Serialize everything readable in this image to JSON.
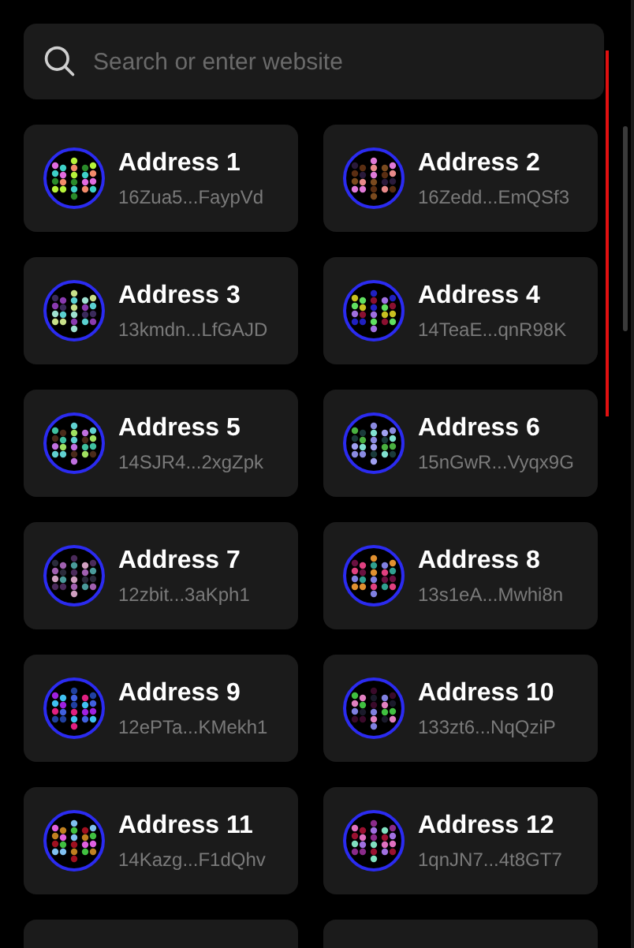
{
  "search": {
    "placeholder": "Search or enter website"
  },
  "addresses": [
    {
      "name": "Address 1",
      "address": "16Zua5...FaypVd"
    },
    {
      "name": "Address 2",
      "address": "16Zedd...EmQSf3"
    },
    {
      "name": "Address 3",
      "address": "13kmdn...LfGAJD"
    },
    {
      "name": "Address 4",
      "address": "14TeaE...qnR98K"
    },
    {
      "name": "Address 5",
      "address": "14SJR4...2xgZpk"
    },
    {
      "name": "Address 6",
      "address": "15nGwR...Vyqx9G"
    },
    {
      "name": "Address 7",
      "address": "12zbit...3aKph1"
    },
    {
      "name": "Address 8",
      "address": "13s1eA...Mwhi8n"
    },
    {
      "name": "Address 9",
      "address": "12ePTa...KMekh1"
    },
    {
      "name": "Address 10",
      "address": "133zt6...NqQziP"
    },
    {
      "name": "Address 11",
      "address": "14Kazg...F1dQhv"
    },
    {
      "name": "Address 12",
      "address": "1qnJN7...4t8GT7"
    }
  ]
}
